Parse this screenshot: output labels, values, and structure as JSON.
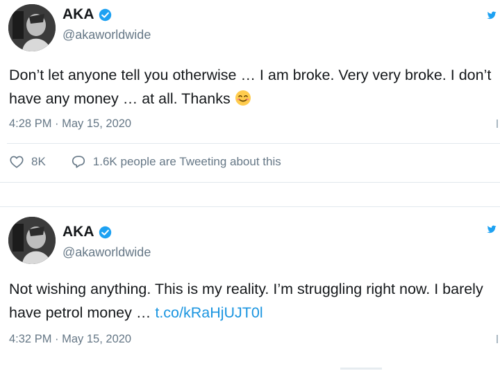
{
  "tweets": [
    {
      "name": "AKA",
      "handle": "@akaworldwide",
      "text": "Don’t let anyone tell you otherwise … I am broke. Very very broke. I don’t have any money … at all. Thanks",
      "emoji": "smiling-face-emoji",
      "timestamp": "4:28 PM · May 15, 2020",
      "likes": "8K",
      "activity": "1.6K people are Tweeting about this"
    },
    {
      "name": "AKA",
      "handle": "@akaworldwide",
      "text": "Not wishing anything. This is my reality. I’m struggling right now. I barely have petrol money … ",
      "link": "t.co/kRaHjUJT0l",
      "timestamp": "4:32 PM · May 15, 2020"
    }
  ],
  "colors": {
    "text": "#14171a",
    "secondary": "#657786",
    "link": "#1b95e0",
    "verified": "#1da1f2",
    "divider": "#e1e8ed"
  },
  "icons": [
    "verified-badge-icon",
    "heart-icon",
    "reply-bubble-icon",
    "twitter-bird-icon",
    "info-icon"
  ]
}
